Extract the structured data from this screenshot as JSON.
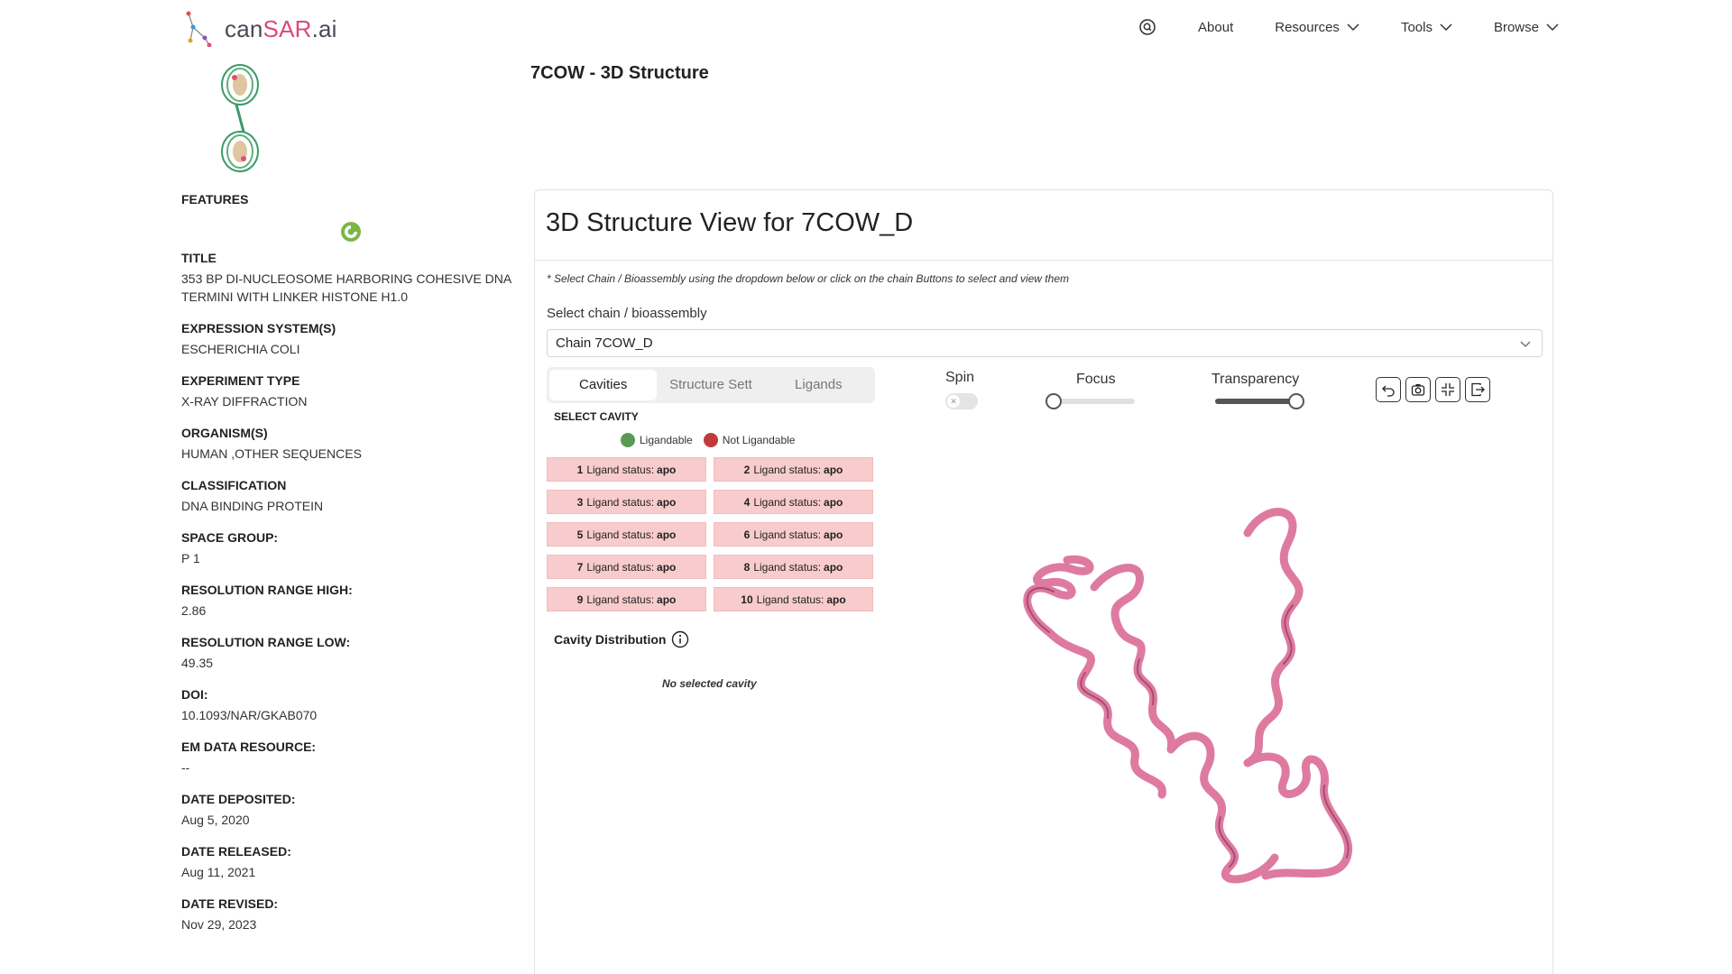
{
  "header": {
    "logo_prefix": "can",
    "logo_accent": "SAR",
    "logo_suffix": ".ai",
    "nav": [
      {
        "label": "About"
      },
      {
        "label": "Resources"
      },
      {
        "label": "Tools"
      },
      {
        "label": "Browse"
      }
    ]
  },
  "page_title": "7COW - 3D Structure",
  "features_title": "FEATURES",
  "metadata": [
    {
      "label": "TITLE",
      "value": "353 BP DI-NUCLEOSOME HARBORING COHESIVE DNA TERMINI WITH LINKER HISTONE H1.0"
    },
    {
      "label": "EXPRESSION SYSTEM(S)",
      "value": "ESCHERICHIA COLI"
    },
    {
      "label": "EXPERIMENT TYPE",
      "value": "X-RAY DIFFRACTION"
    },
    {
      "label": "ORGANISM(S)",
      "value": "HUMAN ,OTHER SEQUENCES"
    },
    {
      "label": "CLASSIFICATION",
      "value": "DNA BINDING PROTEIN"
    },
    {
      "label": "SPACE GROUP:",
      "value": "P 1"
    },
    {
      "label": "RESOLUTION RANGE HIGH:",
      "value": "2.86"
    },
    {
      "label": "RESOLUTION RANGE LOW:",
      "value": "49.35"
    },
    {
      "label": "DOI:",
      "value": "10.1093/NAR/GKAB070"
    },
    {
      "label": "EM DATA RESOURCE:",
      "value": "--"
    },
    {
      "label": "DATE DEPOSITED:",
      "value": "Aug 5, 2020"
    },
    {
      "label": "DATE RELEASED:",
      "value": "Aug 11, 2021"
    },
    {
      "label": "DATE REVISED:",
      "value": "Nov 29, 2023"
    }
  ],
  "panel": {
    "title": "3D Structure View for 7COW_D",
    "hint": "* Select Chain / Bioassembly using the dropdown below or click on the chain Buttons to select and view them",
    "select_label": "Select chain / bioassembly",
    "select_value": "Chain 7COW_D",
    "tabs": [
      {
        "label": "Cavities",
        "active": true
      },
      {
        "label": "Structure Sett",
        "active": false
      },
      {
        "label": "Ligands",
        "active": false
      }
    ],
    "select_cavity": "SELECT CAVITY",
    "legend": [
      {
        "label": "Ligandable",
        "color": "#5a9a55"
      },
      {
        "label": "Not Ligandable",
        "color": "#c0393b"
      }
    ],
    "cavity_status_label": "Ligand status:",
    "cavities": [
      {
        "num": "1",
        "status": "apo"
      },
      {
        "num": "2",
        "status": "apo"
      },
      {
        "num": "3",
        "status": "apo"
      },
      {
        "num": "4",
        "status": "apo"
      },
      {
        "num": "5",
        "status": "apo"
      },
      {
        "num": "6",
        "status": "apo"
      },
      {
        "num": "7",
        "status": "apo"
      },
      {
        "num": "8",
        "status": "apo"
      },
      {
        "num": "9",
        "status": "apo"
      },
      {
        "num": "10",
        "status": "apo"
      }
    ],
    "cavity_distribution": "Cavity Distribution",
    "no_selected_cavity": "No selected cavity",
    "controls": {
      "spin_label": "Spin",
      "spin_on": false,
      "focus_label": "Focus",
      "focus_value": 0.0,
      "transparency_label": "Transparency",
      "transparency_value": 1.0
    },
    "ribbon_color": "#de7aa0"
  }
}
